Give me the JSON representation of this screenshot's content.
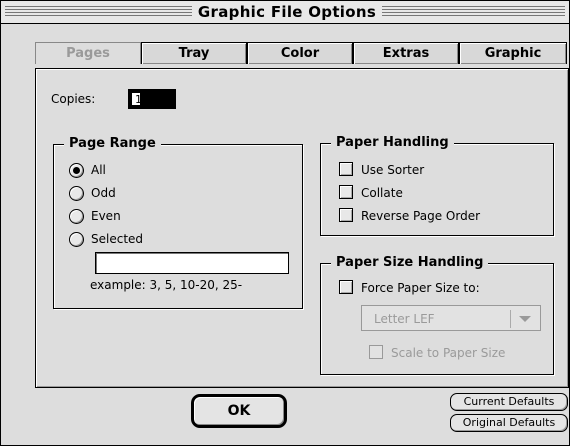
{
  "window": {
    "title": "Graphic File Options"
  },
  "tabs": [
    {
      "label": "Pages",
      "active": true
    },
    {
      "label": "Tray",
      "active": false
    },
    {
      "label": "Color",
      "active": false
    },
    {
      "label": "Extras",
      "active": false
    },
    {
      "label": "Graphic",
      "active": false
    }
  ],
  "copies": {
    "label": "Copies:",
    "value": "1"
  },
  "page_range": {
    "title": "Page Range",
    "options": [
      {
        "label": "All",
        "checked": true
      },
      {
        "label": "Odd",
        "checked": false
      },
      {
        "label": "Even",
        "checked": false
      },
      {
        "label": "Selected",
        "checked": false
      }
    ],
    "selected_value": "",
    "example": "example: 3, 5, 10-20, 25-"
  },
  "paper_handling": {
    "title": "Paper Handling",
    "options": [
      {
        "label": "Use Sorter",
        "checked": false
      },
      {
        "label": "Collate",
        "checked": false
      },
      {
        "label": "Reverse Page Order",
        "checked": false
      }
    ]
  },
  "paper_size_handling": {
    "title": "Paper Size Handling",
    "force_label": "Force Paper Size to:",
    "force_checked": false,
    "paper_size_selected": "Letter LEF",
    "scale_label": "Scale to Paper Size",
    "scale_checked": false
  },
  "buttons": {
    "ok": "OK",
    "current_defaults": "Current Defaults",
    "original_defaults": "Original Defaults"
  }
}
